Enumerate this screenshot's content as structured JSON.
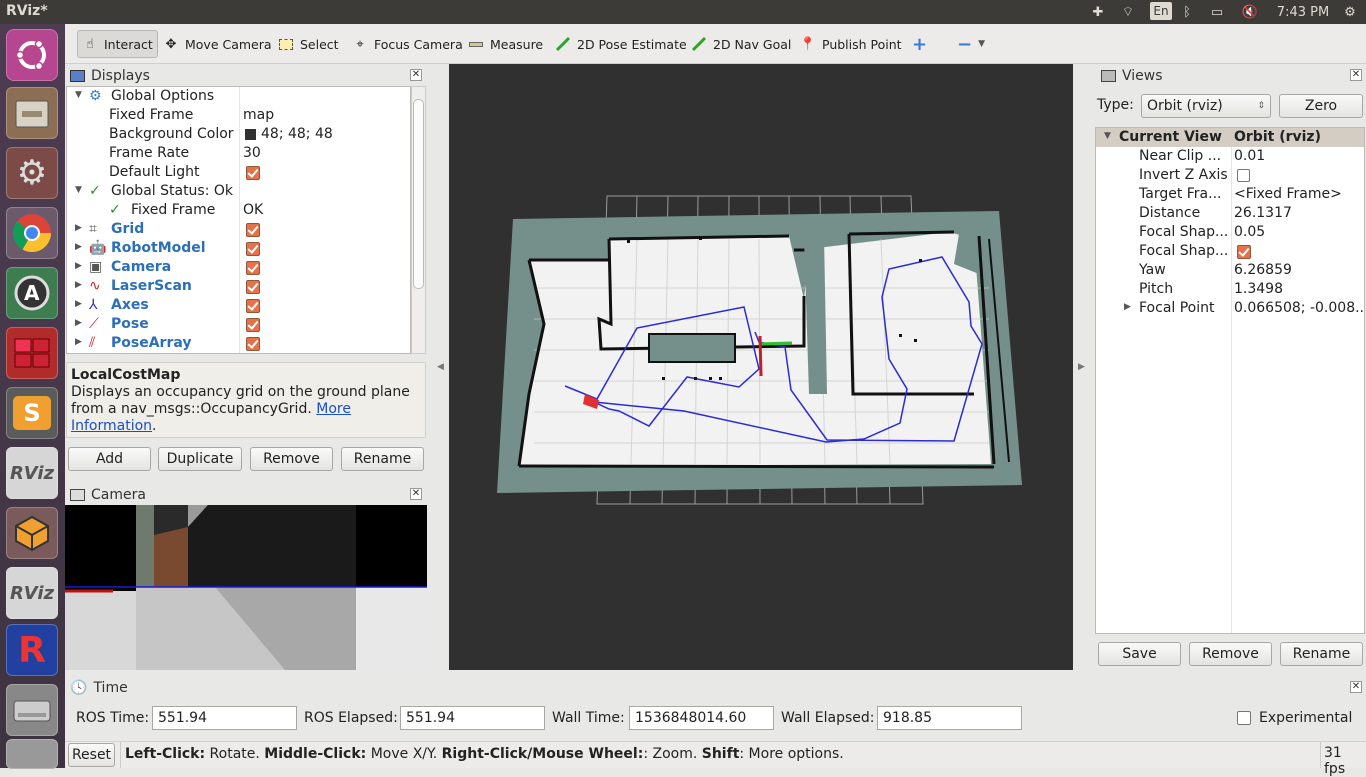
{
  "window": {
    "title": "RViz*"
  },
  "top_indicators": {
    "lang": "En",
    "time": "7:43 PM"
  },
  "toolbar": {
    "tools": [
      "Interact",
      "Move Camera",
      "Select",
      "Focus Camera",
      "Measure",
      "2D Pose Estimate",
      "2D Nav Goal",
      "Publish Point"
    ]
  },
  "displays_panel": {
    "title": "Displays",
    "global_options": {
      "label": "Global Options",
      "fixed_frame_label": "Fixed Frame",
      "fixed_frame_value": "map",
      "background_color_label": "Background Color",
      "background_color_value": "48; 48; 48",
      "frame_rate_label": "Frame Rate",
      "frame_rate_value": "30",
      "default_light_label": "Default Light"
    },
    "global_status": {
      "label": "Global Status: Ok",
      "fixed_frame_label": "Fixed Frame",
      "fixed_frame_value": "OK"
    },
    "items": [
      {
        "label": "Grid",
        "icon": "grid-icon"
      },
      {
        "label": "RobotModel",
        "icon": "robot-icon"
      },
      {
        "label": "Camera",
        "icon": "camera-icon"
      },
      {
        "label": "LaserScan",
        "icon": "laser-icon"
      },
      {
        "label": "Axes",
        "icon": "axes-icon"
      },
      {
        "label": "Pose",
        "icon": "pose-arrow-icon"
      },
      {
        "label": "PoseArray",
        "icon": "pose-array-icon"
      }
    ],
    "description_title": "LocalCostMap",
    "description_text": "Displays an occupancy grid on the ground plane from a nav_msgs::OccupancyGrid.",
    "description_link_1": "More",
    "description_link_2": "Information",
    "buttons": {
      "add": "Add",
      "duplicate": "Duplicate",
      "remove": "Remove",
      "rename": "Rename"
    }
  },
  "camera_panel": {
    "title": "Camera"
  },
  "views_panel": {
    "title": "Views",
    "type_label": "Type:",
    "type_value": "Orbit (rviz)",
    "zero_label": "Zero",
    "header": {
      "name": "Current View",
      "value": "Orbit (rviz)"
    },
    "rows": [
      {
        "label": "Near Clip ...",
        "value": "0.01"
      },
      {
        "label": "Invert Z Axis",
        "value": ""
      },
      {
        "label": "Target Fra...",
        "value": "<Fixed Frame>"
      },
      {
        "label": "Distance",
        "value": "26.1317"
      },
      {
        "label": "Focal Shap...",
        "value": "0.05"
      },
      {
        "label": "Focal Shap...",
        "value": ""
      },
      {
        "label": "Yaw",
        "value": "6.26859"
      },
      {
        "label": "Pitch",
        "value": "1.3498"
      },
      {
        "label": "Focal Point",
        "value": "0.066508; -0.008..."
      }
    ],
    "buttons": {
      "save": "Save",
      "remove": "Remove",
      "rename": "Rename"
    }
  },
  "time_panel": {
    "title": "Time",
    "ros_time_label": "ROS Time:",
    "ros_time": "551.94",
    "ros_elapsed_label": "ROS Elapsed:",
    "ros_elapsed": "551.94",
    "wall_time_label": "Wall Time:",
    "wall_time": "1536848014.60",
    "wall_elapsed_label": "Wall Elapsed:",
    "wall_elapsed": "918.85",
    "experimental_label": "Experimental"
  },
  "status_bar": {
    "reset_label": "Reset",
    "hint_b1": "Left-Click:",
    "hint_t1": " Rotate. ",
    "hint_b2": "Middle-Click:",
    "hint_t2": " Move X/Y. ",
    "hint_b3": "Right-Click/Mouse Wheel:",
    "hint_t3": ": Zoom. ",
    "hint_b4": "Shift",
    "hint_t4": ": More options.",
    "fps": "31 fps"
  },
  "colors": {
    "background": "#303030",
    "path": "#2b2bd6",
    "map_free": "#f0f0f0",
    "map_unknown": "#75908a",
    "checkbox": "#e8714a"
  }
}
